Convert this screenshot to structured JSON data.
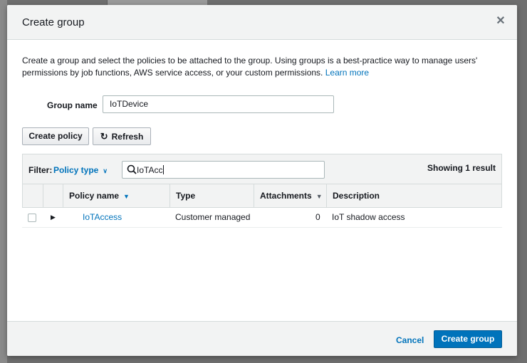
{
  "modal": {
    "title": "Create group",
    "close_icon": "close-icon",
    "intro_text": "Create a group and select the policies to be attached to the group. Using groups is a best-practice way to manage users' permissions by job functions, AWS service access, or your custom permissions.",
    "learn_more": "Learn more"
  },
  "form": {
    "group_name_label": "Group name",
    "group_name_value": "IoTDevice"
  },
  "toolbar": {
    "create_policy_label": "Create policy",
    "refresh_label": "Refresh",
    "refresh_icon": "refresh-icon"
  },
  "filter": {
    "label": "Filter:",
    "type_label": "Policy type",
    "search_value": "IoTAcc",
    "result_count": "Showing 1 result"
  },
  "table": {
    "columns": [
      "Policy name",
      "Type",
      "Attachments",
      "Description"
    ],
    "rows": [
      {
        "policy_name": "IoTAccess",
        "type": "Customer managed",
        "attachments": "0",
        "description": "IoT shadow access"
      }
    ]
  },
  "footer": {
    "cancel_label": "Cancel",
    "create_group_label": "Create group"
  },
  "colors": {
    "accent": "#0073bb",
    "header_bg": "#f2f3f3",
    "border": "#d5dbdb"
  }
}
